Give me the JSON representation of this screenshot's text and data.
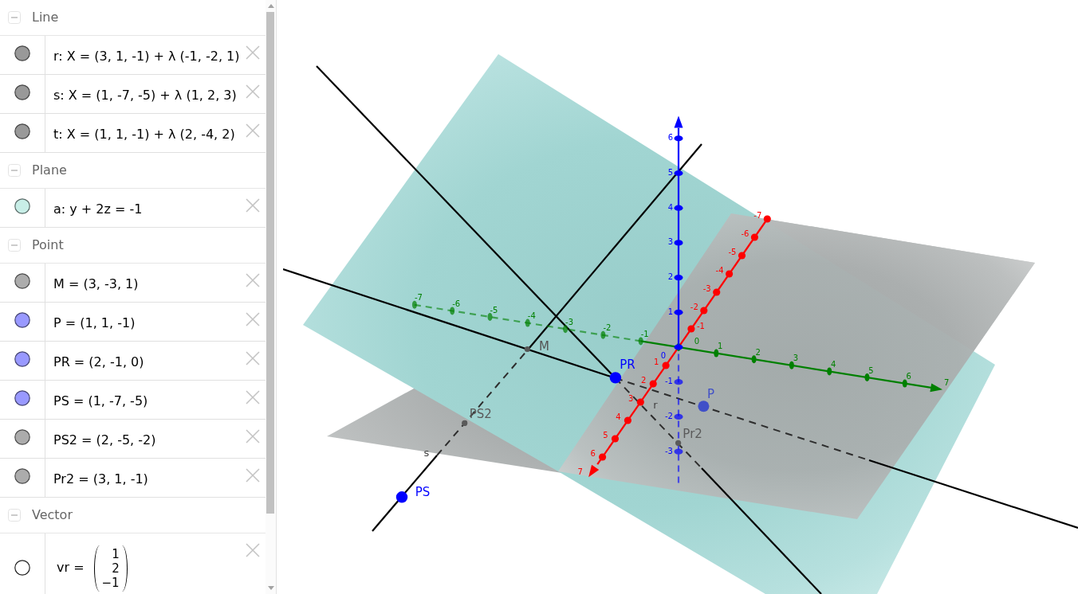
{
  "algebra_view": {
    "groups": [
      {
        "title": "Line",
        "expanded": true,
        "items": [
          {
            "kind": "formula",
            "text": "r: X = (3, 1, -1) + λ (-1, -2, 1)",
            "shown": true,
            "color": "#999999"
          },
          {
            "kind": "formula",
            "text": "s: X = (1, -7, -5) + λ (1, 2, 3)",
            "shown": true,
            "color": "#999999"
          },
          {
            "kind": "formula",
            "text": "t: X = (1, 1, -1) + λ (2, -4, 2)",
            "shown": true,
            "color": "#999999"
          }
        ]
      },
      {
        "title": "Plane",
        "expanded": true,
        "items": [
          {
            "kind": "formula",
            "text": "a: y + 2z = -1",
            "shown": true,
            "color": "#c8eee7"
          }
        ]
      },
      {
        "title": "Point",
        "expanded": true,
        "items": [
          {
            "kind": "formula",
            "text": "M = (3, -3, 1)",
            "shown": true,
            "color": "#acacac"
          },
          {
            "kind": "formula",
            "text": "P = (1, 1, -1)",
            "shown": true,
            "color": "#9999ff"
          },
          {
            "kind": "formula",
            "text": "PR = (2, -1, 0)",
            "shown": true,
            "color": "#9999ff"
          },
          {
            "kind": "formula",
            "text": "PS = (1, -7, -5)",
            "shown": true,
            "color": "#9999ff"
          },
          {
            "kind": "formula",
            "text": "PS2 = (2, -5, -2)",
            "shown": true,
            "color": "#acacac"
          },
          {
            "kind": "formula",
            "text": "Pr2 = (3, 1, -1)",
            "shown": true,
            "color": "#acacac"
          }
        ]
      },
      {
        "title": "Vector",
        "expanded": true,
        "items": [
          {
            "kind": "vector",
            "label": "vr =",
            "components": [
              "1",
              "2",
              "−1"
            ],
            "shown": false
          }
        ]
      }
    ]
  },
  "graphics_view": {
    "axes": [
      {
        "kind": "x",
        "color": "#ff0000",
        "ticks": [
          "-7",
          "-6",
          "-5",
          "-4",
          "-3",
          "-2",
          "-1",
          "1",
          "2",
          "3",
          "4",
          "5",
          "6",
          "7"
        ]
      },
      {
        "kind": "y",
        "color": "#008000",
        "ticks": [
          "-7",
          "-6",
          "-5",
          "-4",
          "-3",
          "-2",
          "-1",
          "0",
          "1",
          "2",
          "3",
          "4",
          "5",
          "6",
          "7"
        ]
      },
      {
        "kind": "z",
        "color": "#0000ff",
        "ticks": [
          "6",
          "5",
          "4",
          "3",
          "2",
          "1",
          "0",
          "-1",
          "-2",
          "-3"
        ]
      }
    ],
    "line_labels": [
      "r",
      "s"
    ],
    "points": [
      {
        "label": "M",
        "color": "#555555"
      },
      {
        "label": "PR",
        "color": "#0000ff"
      },
      {
        "label": "P",
        "color": "#4050c8"
      },
      {
        "label": "PS2",
        "color": "#5a5a5a"
      },
      {
        "label": "Pr2",
        "color": "#5a5a5a"
      },
      {
        "label": "PS",
        "color": "#0000ff"
      }
    ]
  }
}
